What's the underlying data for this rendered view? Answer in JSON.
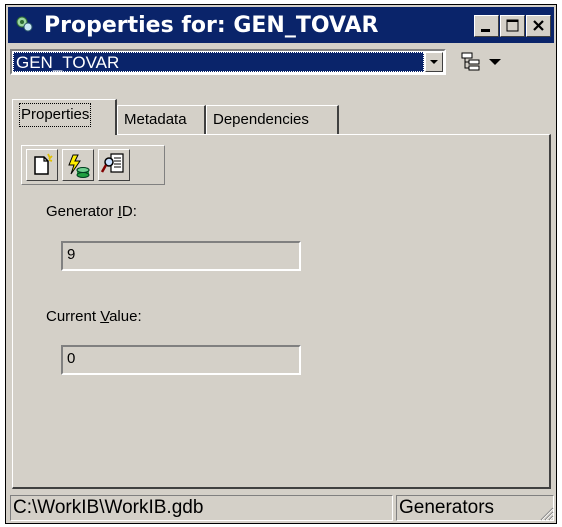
{
  "window": {
    "title": "Properties for: GEN_TOVAR",
    "controls": {
      "minimize_icon": "minimize-icon",
      "maximize_icon": "maximize-icon",
      "close_icon": "close-icon"
    }
  },
  "selector": {
    "value": "GEN_TOVAR",
    "tree_icon": "tree-icon",
    "dropdown_icon": "dropdown-arrow-icon"
  },
  "tabs": [
    {
      "label": "Properties",
      "active": true
    },
    {
      "label": "Metadata",
      "active": false
    },
    {
      "label": "Dependencies",
      "active": false
    }
  ],
  "toolbar": {
    "buttons": [
      {
        "icon": "new-document-icon"
      },
      {
        "icon": "execute-database-icon"
      },
      {
        "icon": "search-document-icon"
      }
    ]
  },
  "fields": {
    "generator_id": {
      "label_pre": "Generator ",
      "label_key": "I",
      "label_post": "D:",
      "value": "9"
    },
    "current_value": {
      "label_pre": "Current ",
      "label_key": "V",
      "label_post": "alue:",
      "value": "0"
    }
  },
  "status": {
    "path": "C:\\WorkIB\\WorkIB.gdb",
    "category": "Generators"
  },
  "colors": {
    "title_bar": "#0a246a",
    "face": "#d4d0c8",
    "selection": "#0a246a"
  }
}
